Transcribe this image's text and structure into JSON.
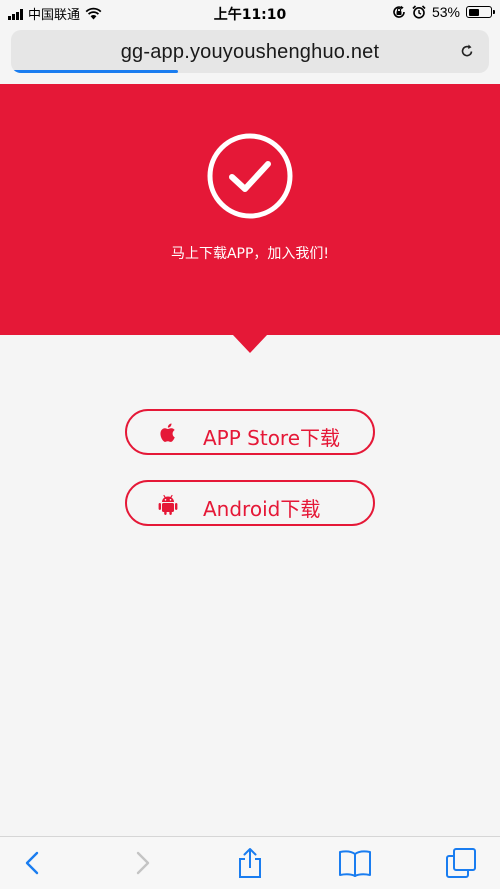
{
  "status_bar": {
    "carrier": "中国联通",
    "time": "上午11:10",
    "battery": "53%",
    "icons": [
      "signal-icon",
      "wifi-icon",
      "orientation-lock-icon",
      "alarm-icon",
      "battery-icon"
    ]
  },
  "browser": {
    "url": "gg-app.youyoushenghuo.net",
    "load_progress": 0.35,
    "icons": [
      "reload-icon"
    ]
  },
  "hero": {
    "message": "马上下载APP，加入我们!",
    "background_color": "#e51837",
    "icon": "checkmark-circle-icon"
  },
  "downloads": {
    "appstore_label": "APP Store下载",
    "appstore_icon": "apple-icon",
    "android_label": "Android下载",
    "android_icon": "android-icon",
    "accent_color": "#e51837"
  },
  "toolbar": {
    "items": [
      "back-icon",
      "forward-icon",
      "share-icon",
      "bookmarks-icon",
      "tabs-icon"
    ],
    "accent_color": "#1a7df0"
  }
}
